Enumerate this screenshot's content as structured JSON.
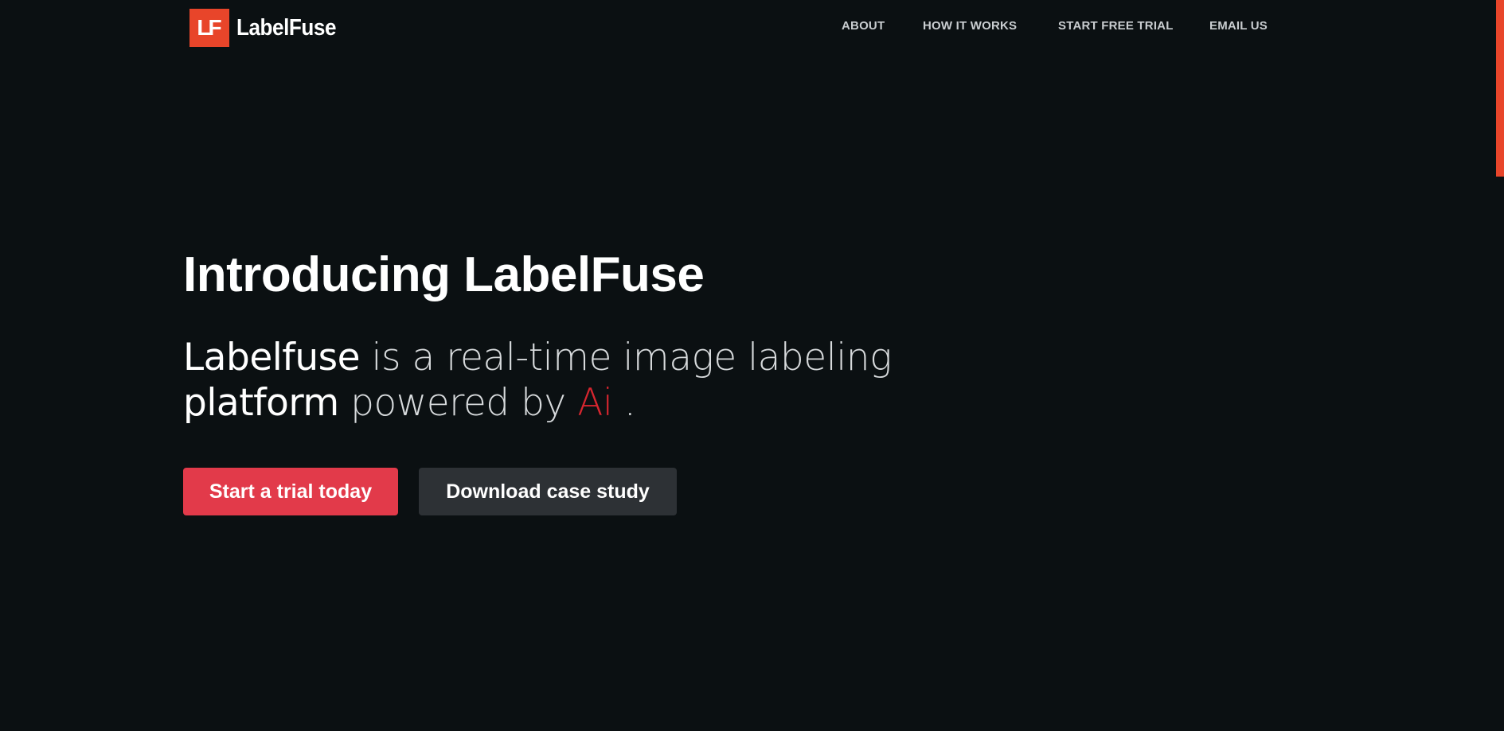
{
  "brand": {
    "logo_mark": "LF",
    "name": "LabelFuse",
    "accent_color": "#e8452a"
  },
  "nav": {
    "items": [
      {
        "label": "ABOUT"
      },
      {
        "label": "HOW IT WORKS"
      },
      {
        "label": "START FREE TRIAL"
      },
      {
        "label": "EMAIL US"
      }
    ]
  },
  "hero": {
    "title": "Introducing LabelFuse",
    "subtitle_parts": {
      "p1": "Labelfuse",
      "p2": " is a real-time image labeling ",
      "p3": "platform",
      "p4": " powered by ",
      "p5": "Ai",
      "p6": " ."
    },
    "primary_cta": "Start a trial today",
    "secondary_cta": "Download case study"
  },
  "colors": {
    "background": "#0b1012",
    "primary_button": "#e23a4a",
    "secondary_button": "#2d3135",
    "ai_highlight": "#d7262f"
  }
}
